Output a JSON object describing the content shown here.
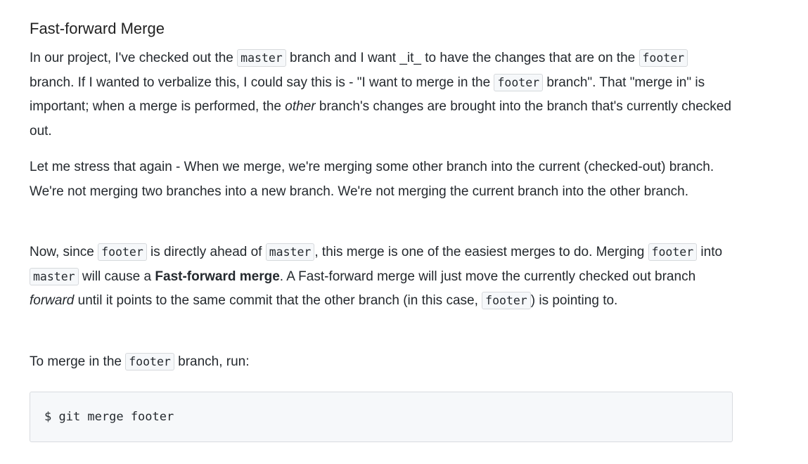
{
  "heading": "Fast-forward Merge",
  "p1": {
    "t1": "In our project, I've checked out the ",
    "c1": "master",
    "t2": " branch and I want _it_ to have the changes that are on the ",
    "c2": "footer",
    "t3": " branch. If I wanted to verbalize this, I could say this is - \"I want to merge in the ",
    "c3": "footer",
    "t4": " branch\". That \"merge in\" is important; when a merge is performed, the ",
    "em1": "other",
    "t5": " branch's changes are brought into the branch that's currently checked out."
  },
  "p2": {
    "text": "Let me stress that again - When we merge, we're merging some other branch into the current (checked-out) branch. We're not merging two branches into a new branch. We're not merging the current branch into the other branch."
  },
  "p3": {
    "t1": "Now, since ",
    "c1": "footer",
    "t2": " is directly ahead of ",
    "c2": "master",
    "t3": ", this merge is one of the easiest merges to do. Merging ",
    "c3": "footer",
    "t4": " into ",
    "c4": "master",
    "t5": " will cause a ",
    "strong1": "Fast-forward merge",
    "t6": ". A Fast-forward merge will just move the currently checked out branch ",
    "em1": "forward",
    "t7": " until it points to the same commit that the other branch (in this case, ",
    "c5": "footer",
    "t8": ") is pointing to."
  },
  "p4": {
    "t1": "To merge in the ",
    "c1": "footer",
    "t2": " branch, run:"
  },
  "code_block": {
    "command": "$ git merge footer"
  }
}
